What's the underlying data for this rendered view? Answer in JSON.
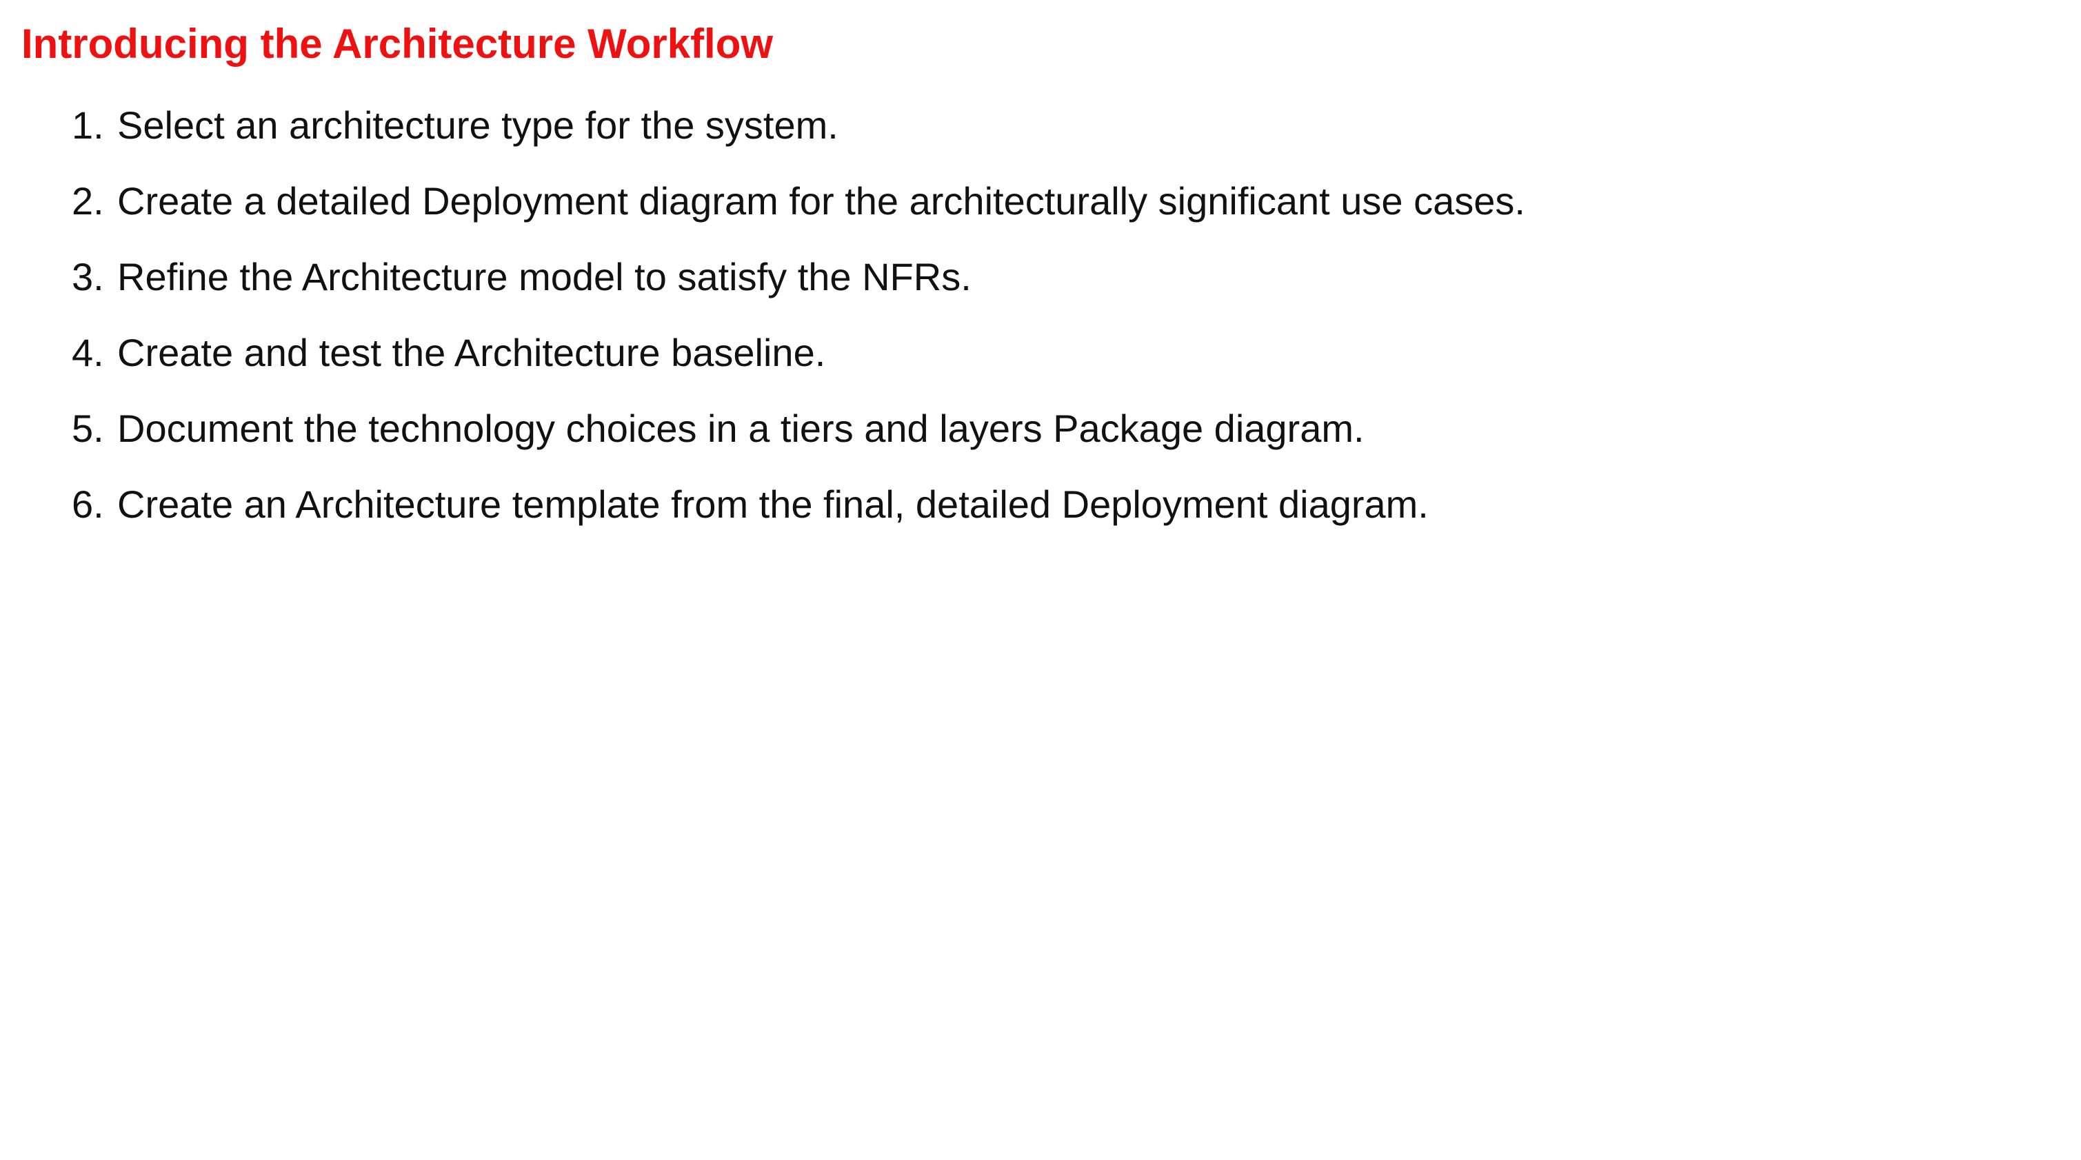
{
  "page": {
    "title": "Introducing the Architecture Workflow",
    "title_color": "#ee1111",
    "text_color": "#111111",
    "background_color": "#ffffff"
  },
  "steps": [
    {
      "number": "1.",
      "text": "Select an architecture type for the system."
    },
    {
      "number": "2.",
      "text": "Create a detailed Deployment diagram for the architecturally significant use cases."
    },
    {
      "number": "3.",
      "text": "Refine the Architecture model to satisfy the NFRs."
    },
    {
      "number": "4.",
      "text": "Create and test the Architecture baseline."
    },
    {
      "number": "5.",
      "text": "Document the technology choices in a tiers and layers Package diagram."
    },
    {
      "number": "6.",
      "text": "Create an Architecture template from the final, detailed Deployment diagram."
    }
  ]
}
